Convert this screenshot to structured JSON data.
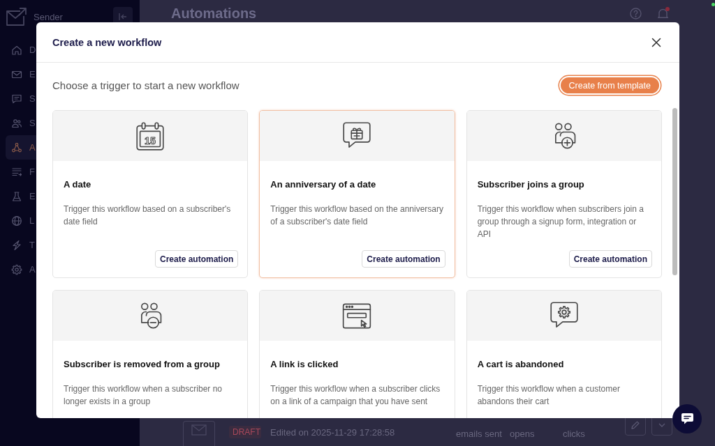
{
  "sidebar": {
    "brand": "Sender",
    "items": [
      {
        "label": "D",
        "selected": false
      },
      {
        "label": "E",
        "selected": false
      },
      {
        "label": "S",
        "selected": false
      },
      {
        "label": "S",
        "selected": false
      },
      {
        "label": "A",
        "selected": true
      },
      {
        "label": "F",
        "selected": false
      },
      {
        "label": "E",
        "selected": false
      },
      {
        "label": "L",
        "selected": false
      },
      {
        "label": "T",
        "selected": false
      },
      {
        "label": "A",
        "selected": false
      }
    ]
  },
  "page": {
    "title": "Automations",
    "has_unread_notifications": true
  },
  "list_row": {
    "status": "DRAFT",
    "edited": "Edited on 2025-11-29 17:28:58",
    "stats": [
      "emails sent",
      "opens",
      "clicks"
    ]
  },
  "modal": {
    "title": "Create a new workflow",
    "subtitle": "Choose a trigger to start a new workflow",
    "template_button": "Create from template",
    "cards": [
      {
        "title": "A date",
        "description": "Trigger this workflow based on a subscriber's date field",
        "button": "Create automation",
        "selected": false,
        "icon_label": "15"
      },
      {
        "title": "An anniversary of a date",
        "description": "Trigger this workflow based on the anniversary of a subscriber's date field",
        "button": "Create automation",
        "selected": true
      },
      {
        "title": "Subscriber joins a group",
        "description": "Trigger this workflow when subscribers join a group through a signup form, integration or API",
        "button": "Create automation",
        "selected": false
      },
      {
        "title": "Subscriber is removed from a group",
        "description": "Trigger this workflow when a subscriber no longer exists in a group",
        "selected": false
      },
      {
        "title": "A link is clicked",
        "description": "Trigger this workflow when a subscriber clicks on a link of a campaign that you have sent",
        "selected": false
      },
      {
        "title": "A cart is abandoned",
        "description": "Trigger this workflow when a customer abandons their cart",
        "selected": false
      }
    ]
  }
}
